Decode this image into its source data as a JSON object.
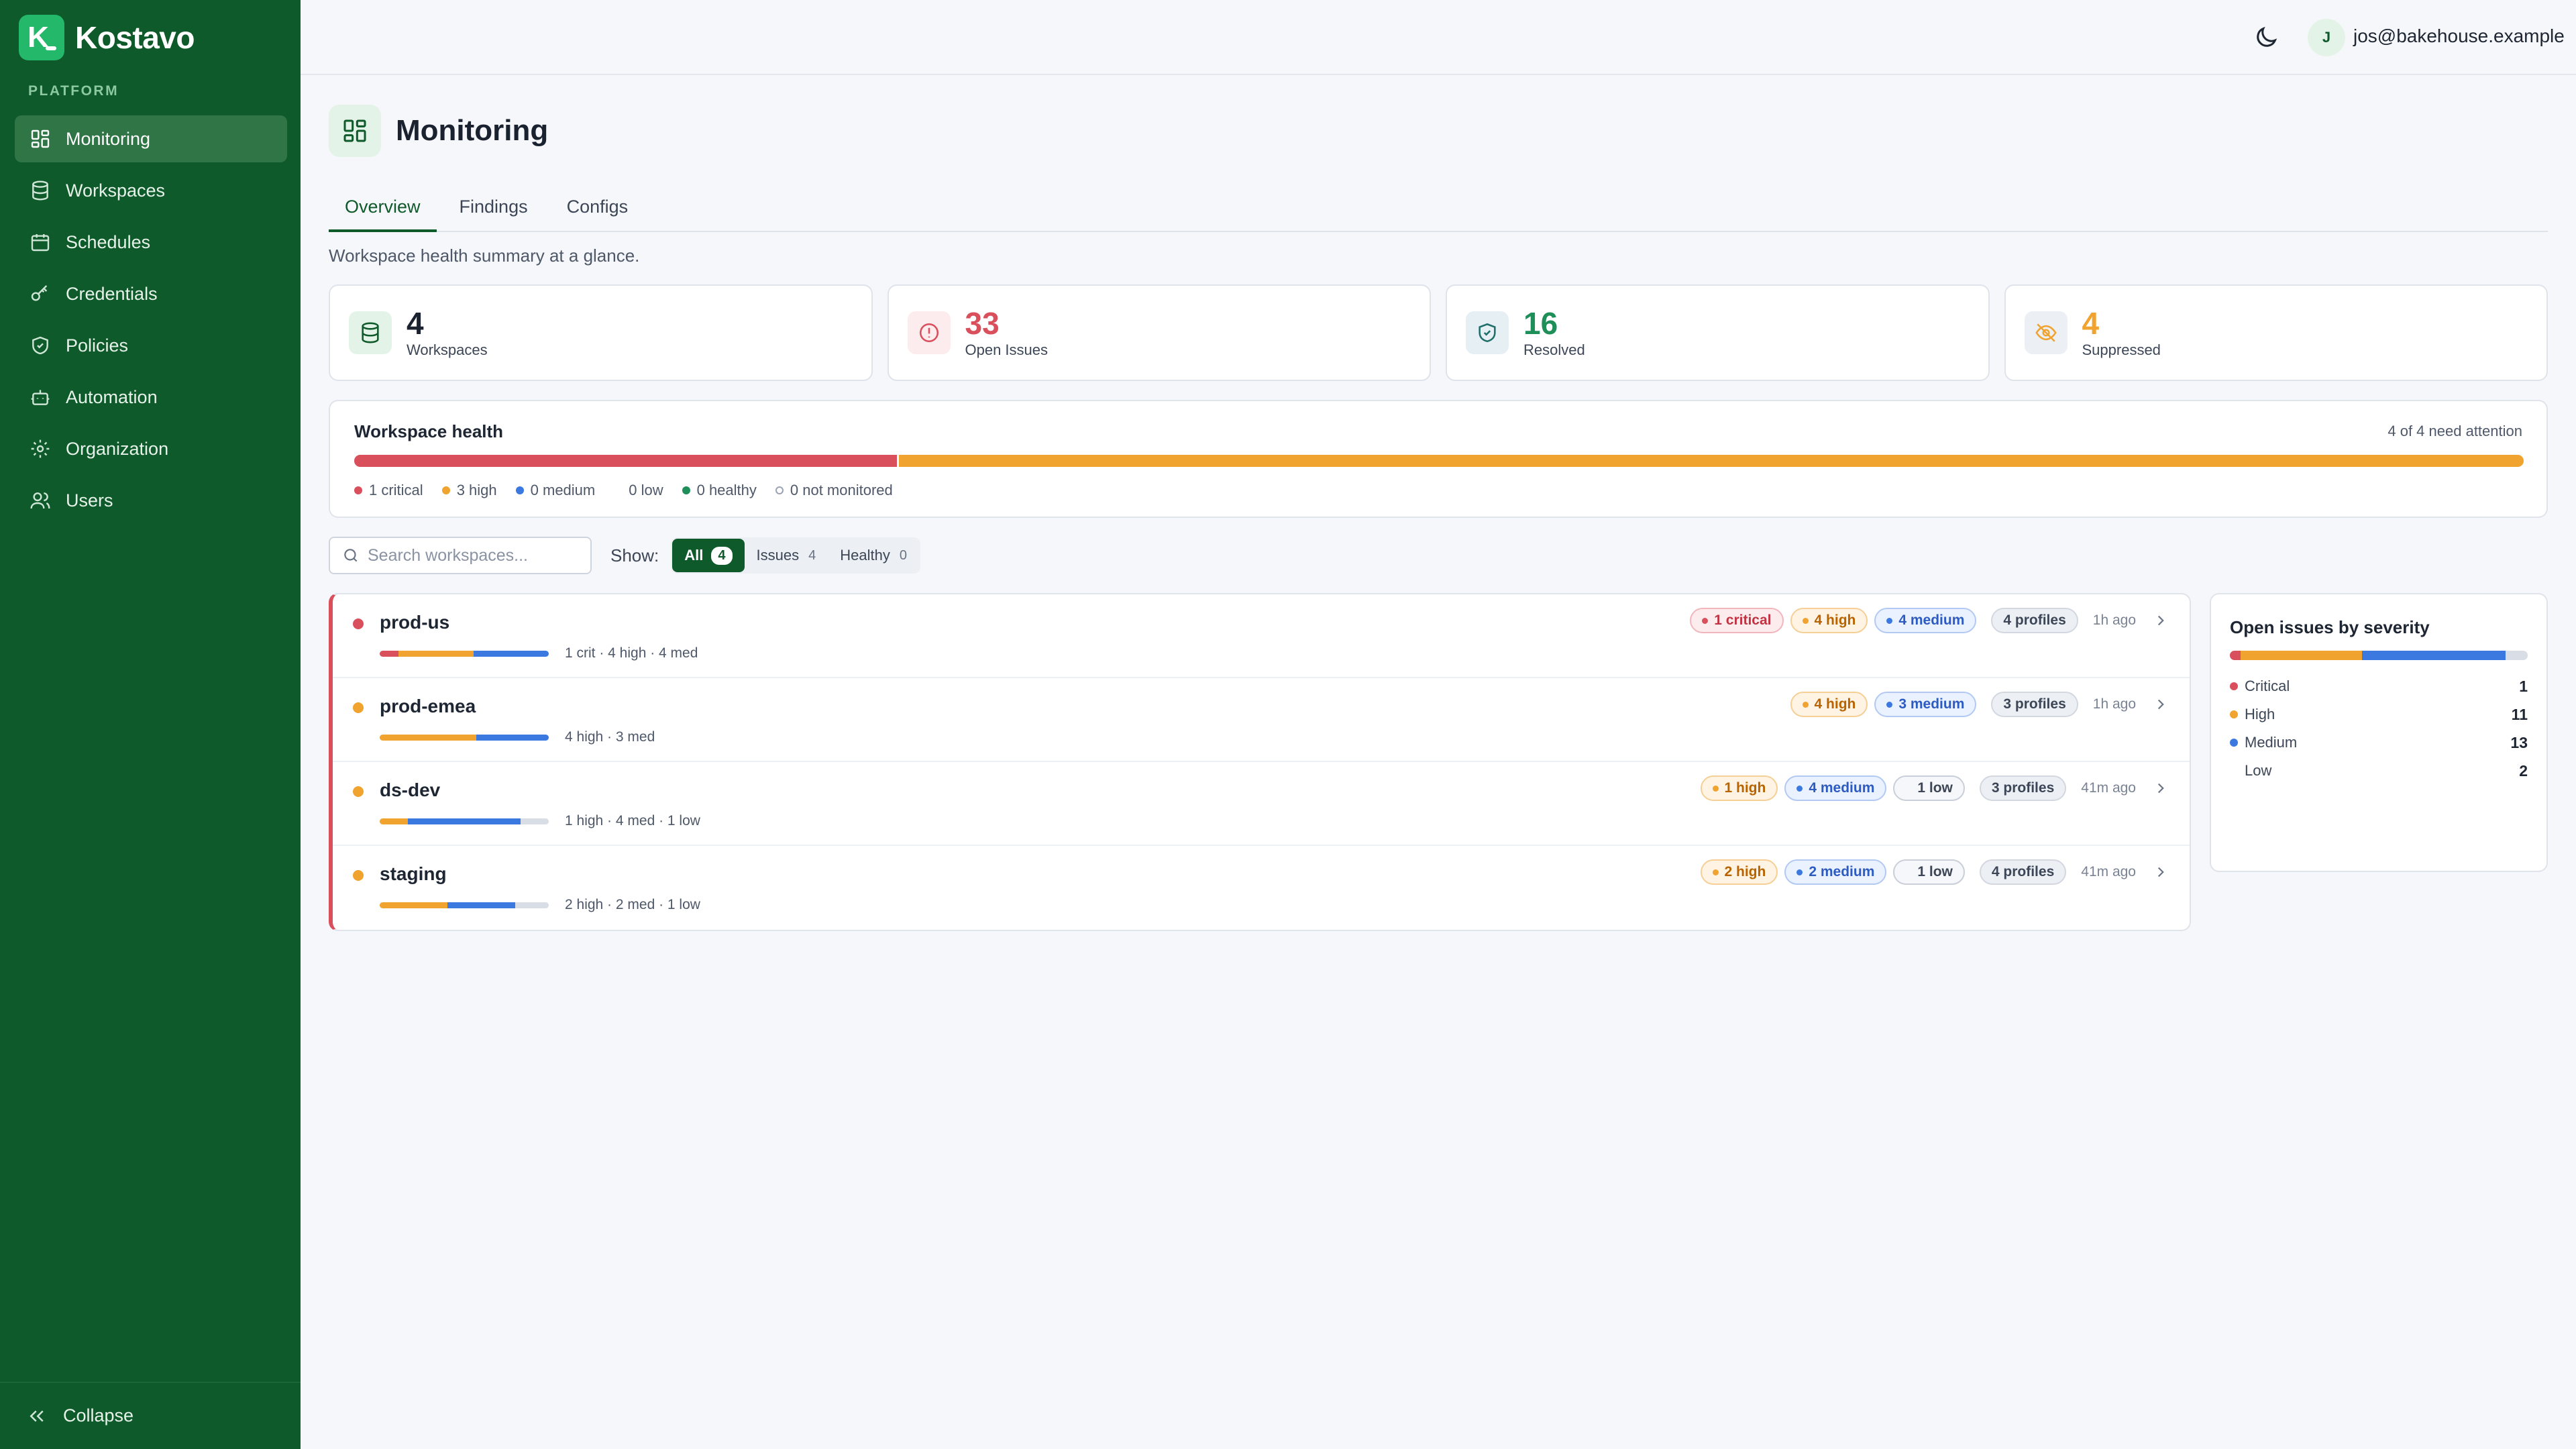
{
  "app": {
    "brand_initial": "K",
    "brand_name": "Kostavo",
    "section_label": "PLATFORM",
    "collapse_label": "Collapse"
  },
  "sidebar": {
    "items": [
      {
        "label": "Monitoring",
        "icon": "dashboard-icon",
        "active": true
      },
      {
        "label": "Workspaces",
        "icon": "database-icon"
      },
      {
        "label": "Schedules",
        "icon": "calendar-icon"
      },
      {
        "label": "Credentials",
        "icon": "key-icon"
      },
      {
        "label": "Policies",
        "icon": "shield-icon"
      },
      {
        "label": "Automation",
        "icon": "robot-icon"
      },
      {
        "label": "Organization",
        "icon": "gear-icon"
      },
      {
        "label": "Users",
        "icon": "users-icon"
      }
    ]
  },
  "topbar": {
    "avatar_initial": "J",
    "user_email": "jos@bakehouse.example"
  },
  "page": {
    "title": "Monitoring",
    "tabs": [
      "Overview",
      "Findings",
      "Configs"
    ],
    "subtitle": "Workspace health summary at a glance."
  },
  "stats": [
    {
      "value": "4",
      "label": "Workspaces",
      "color": "#1a2230"
    },
    {
      "value": "33",
      "label": "Open Issues",
      "color": "#d94f5c"
    },
    {
      "value": "16",
      "label": "Resolved",
      "color": "#1f8f5a"
    },
    {
      "value": "4",
      "label": "Suppressed",
      "color": "#f0a32f"
    }
  ],
  "health": {
    "title": "Workspace health",
    "attention": "4 of 4 need attention",
    "distribution": {
      "critical": 1,
      "high": 3,
      "medium": 0,
      "low": 0,
      "healthy": 0,
      "not_monitored": 0
    },
    "legend": [
      "1 critical",
      "3 high",
      "0 medium",
      "0 low",
      "0 healthy",
      "0 not monitored"
    ]
  },
  "filters": {
    "search_placeholder": "Search workspaces...",
    "show_label": "Show:",
    "options": [
      {
        "label": "All",
        "count": "4",
        "active": true
      },
      {
        "label": "Issues",
        "count": "4"
      },
      {
        "label": "Healthy",
        "count": "0"
      }
    ]
  },
  "workspaces": [
    {
      "name": "prod-us",
      "status": "critical",
      "counts": {
        "critical": 1,
        "high": 4,
        "medium": 4,
        "low": 0
      },
      "summary": "1 crit · 4 high · 4 med",
      "pills": [
        {
          "kind": "critical",
          "label": "1 critical"
        },
        {
          "kind": "high",
          "label": "4 high"
        },
        {
          "kind": "medium",
          "label": "4 medium"
        }
      ],
      "profiles": "4 profiles",
      "time": "1h ago"
    },
    {
      "name": "prod-emea",
      "status": "high",
      "counts": {
        "critical": 0,
        "high": 4,
        "medium": 3,
        "low": 0
      },
      "summary": "4 high · 3 med",
      "pills": [
        {
          "kind": "high",
          "label": "4 high"
        },
        {
          "kind": "medium",
          "label": "3 medium"
        }
      ],
      "profiles": "3 profiles",
      "time": "1h ago"
    },
    {
      "name": "ds-dev",
      "status": "high",
      "counts": {
        "critical": 0,
        "high": 1,
        "medium": 4,
        "low": 1
      },
      "summary": "1 high · 4 med · 1 low",
      "pills": [
        {
          "kind": "high",
          "label": "1 high"
        },
        {
          "kind": "medium",
          "label": "4 medium"
        },
        {
          "kind": "low",
          "label": "1 low"
        }
      ],
      "profiles": "3 profiles",
      "time": "41m ago"
    },
    {
      "name": "staging",
      "status": "high",
      "counts": {
        "critical": 0,
        "high": 2,
        "medium": 2,
        "low": 1
      },
      "summary": "2 high · 2 med · 1 low",
      "pills": [
        {
          "kind": "high",
          "label": "2 high"
        },
        {
          "kind": "medium",
          "label": "2 medium"
        },
        {
          "kind": "low",
          "label": "1 low"
        }
      ],
      "profiles": "4 profiles",
      "time": "41m ago"
    }
  ],
  "severity": {
    "title": "Open issues by severity",
    "rows": [
      {
        "name": "Critical",
        "value": 1,
        "color": "#d94f5c"
      },
      {
        "name": "High",
        "value": 11,
        "color": "#f0a32f"
      },
      {
        "name": "Medium",
        "value": 13,
        "color": "#3b78e0"
      },
      {
        "name": "Low",
        "value": 2,
        "color": "#d8dde6"
      }
    ]
  },
  "colors": {
    "critical": "#d94f5c",
    "high": "#f0a32f",
    "medium": "#3b78e0",
    "low": "#d8dde6",
    "healthy": "#1f8f5a",
    "brand": "#0e5a2a"
  }
}
